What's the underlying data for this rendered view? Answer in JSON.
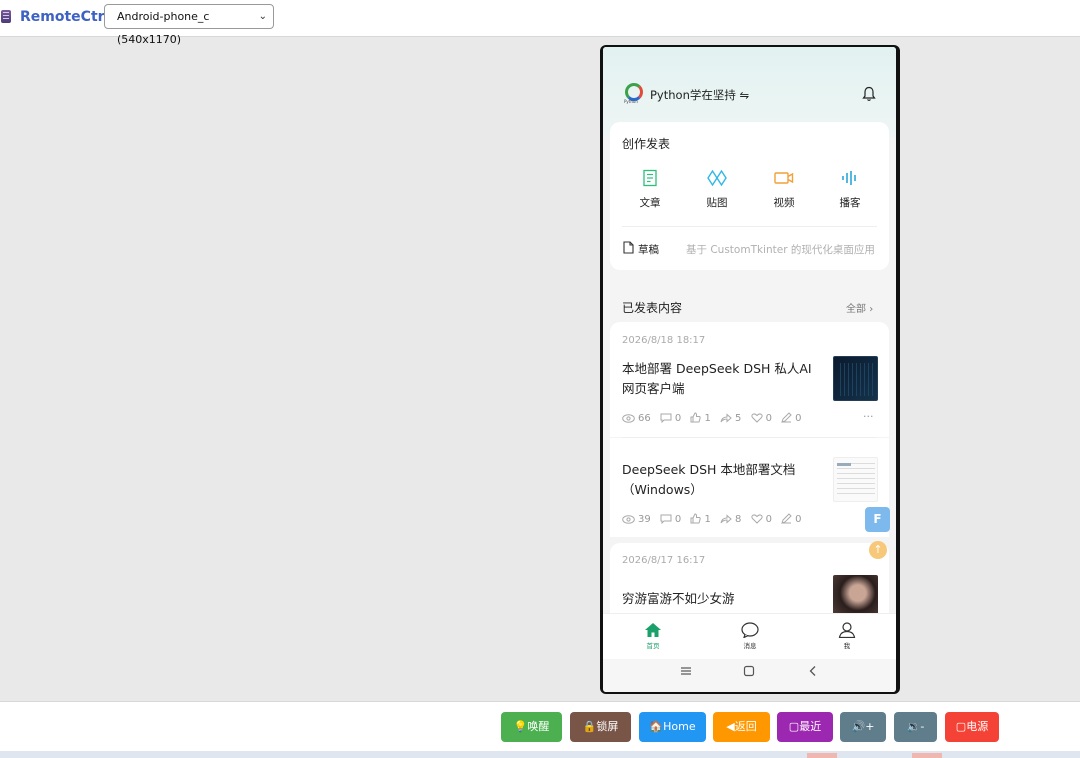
{
  "app": {
    "title": "RemoteCtrl",
    "icon": "app-icon"
  },
  "device_select": {
    "value": "Android-phone_c (540x1170)"
  },
  "phone": {
    "header": {
      "logo_text": "Python",
      "username": "Python学在坚持 ⇋"
    },
    "create": {
      "title": "创作发表",
      "tools": [
        {
          "label": "文章",
          "icon": "article-icon",
          "color": "#2cbf7a"
        },
        {
          "label": "贴图",
          "icon": "image-post-icon",
          "color": "#2fb7e8"
        },
        {
          "label": "视频",
          "icon": "video-icon",
          "color": "#f2a03a"
        },
        {
          "label": "播客",
          "icon": "podcast-icon",
          "color": "#2aa7d8"
        }
      ],
      "draft_label": "草稿",
      "draft_preview": "基于 CustomTkinter 的现代化桌面应用"
    },
    "published": {
      "title": "已发表内容",
      "all_label": "全部"
    },
    "posts": [
      {
        "date": "2026/8/18 18:17",
        "title": "本地部署 DeepSeek DSH 私人AI网页客户端",
        "views": "66",
        "comments": "0",
        "likes": "1",
        "shares": "5",
        "favorites": "0",
        "edits": "0",
        "more": "···"
      },
      {
        "date": "",
        "title": "DeepSeek DSH 本地部署文档（Windows）",
        "views": "39",
        "comments": "0",
        "likes": "1",
        "shares": "8",
        "favorites": "0",
        "edits": "0"
      },
      {
        "date": "2026/8/17 16:17",
        "title": "穷游富游不如少女游"
      }
    ],
    "floats": {
      "f_label": "F",
      "up_label": "↑"
    },
    "tabs": [
      {
        "label": "首页",
        "icon": "home-icon"
      },
      {
        "label": "消息",
        "icon": "message-icon"
      },
      {
        "label": "我",
        "icon": "profile-icon"
      }
    ],
    "nav": [
      "menu-icon",
      "home-square-icon",
      "back-chevron-icon"
    ]
  },
  "controls": [
    {
      "label": "💡唤醒",
      "color": "#4caf50"
    },
    {
      "label": "🔒锁屏",
      "color": "#795548"
    },
    {
      "label": "🏠Home",
      "color": "#2196f3"
    },
    {
      "label": "◀返回",
      "color": "#ff9800"
    },
    {
      "label": "▢最近",
      "color": "#9c27b0"
    },
    {
      "label": "🔊+",
      "color": "#607d8b"
    },
    {
      "label": "🔉-",
      "color": "#607d8b"
    },
    {
      "label": "▢电源",
      "color": "#f44336"
    }
  ],
  "colors": {
    "accent": "#1aa06a",
    "title_blue": "#3d62c4"
  }
}
